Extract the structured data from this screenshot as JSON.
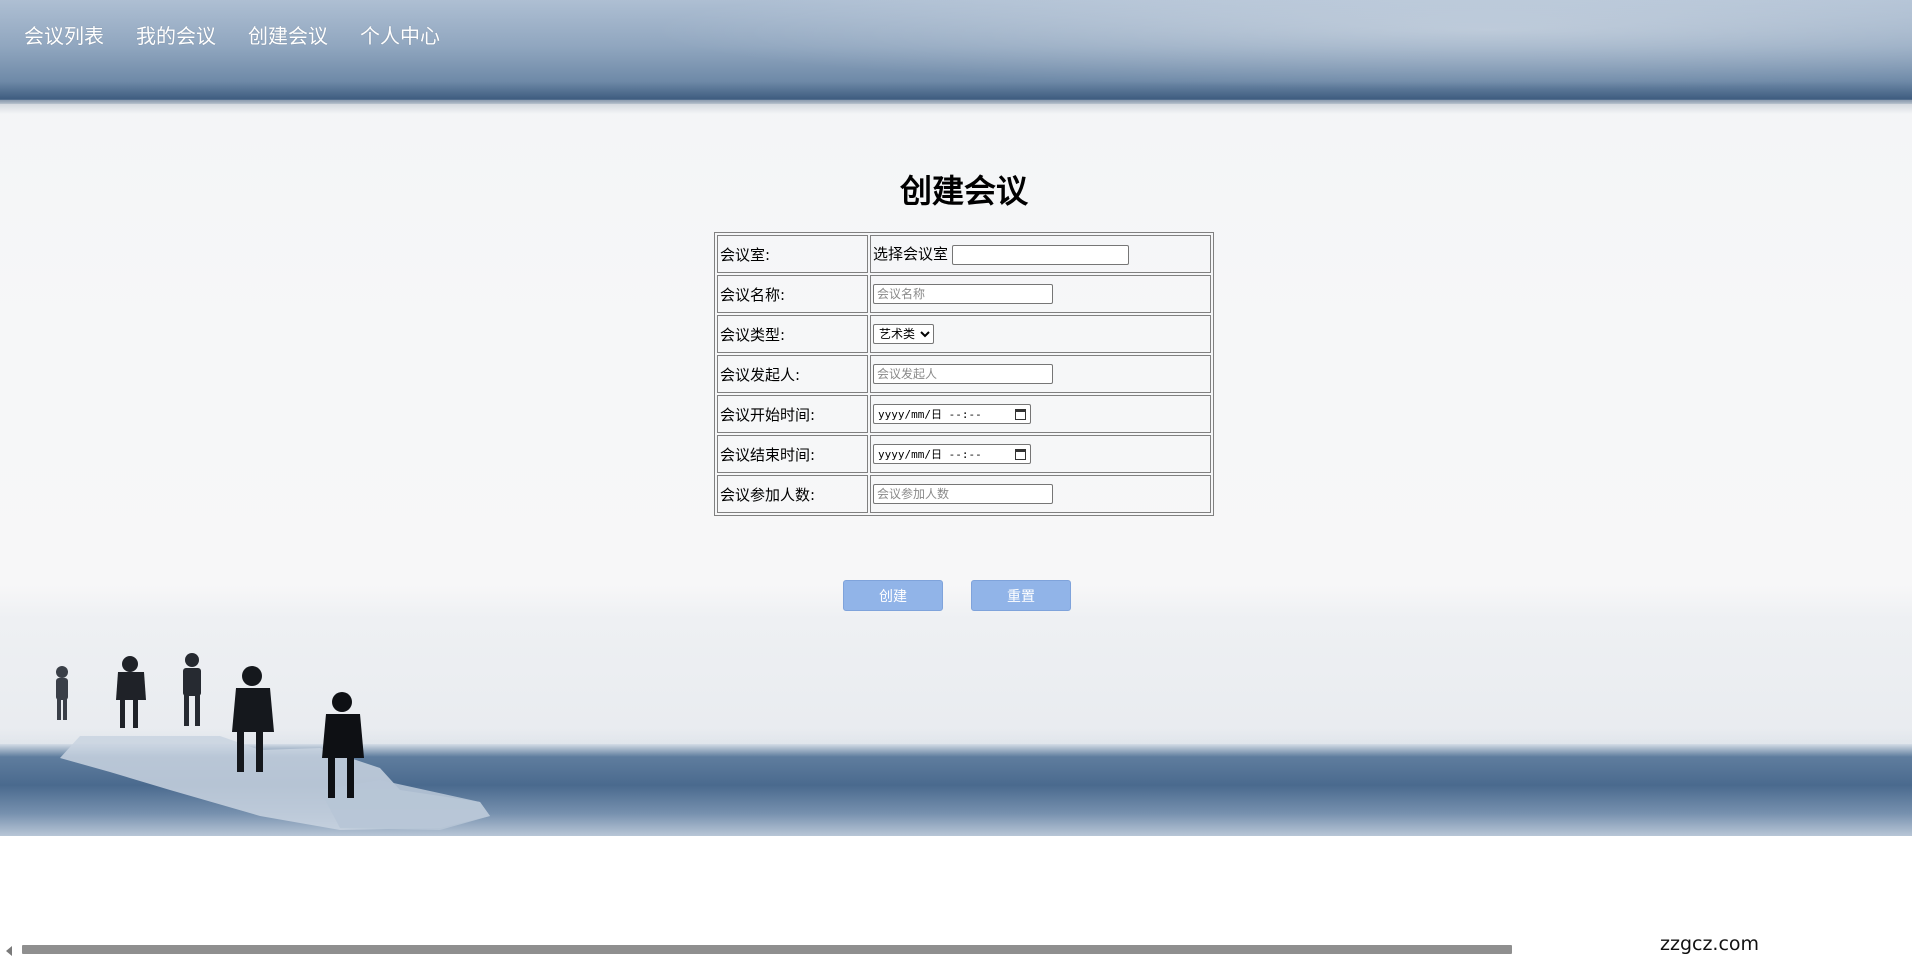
{
  "nav": {
    "items": [
      {
        "label": "会议列表"
      },
      {
        "label": "我的会议"
      },
      {
        "label": "创建会议"
      },
      {
        "label": "个人中心"
      }
    ]
  },
  "page_title": "创建会议",
  "form": {
    "room": {
      "label": "会议室:",
      "prompt": "选择会议室",
      "value": ""
    },
    "name": {
      "label": "会议名称:",
      "placeholder": "会议名称"
    },
    "type": {
      "label": "会议类型:",
      "selected": "艺术类"
    },
    "initiator": {
      "label": "会议发起人:",
      "placeholder": "会议发起人"
    },
    "start_time": {
      "label": "会议开始时间:",
      "value": "yyyy/mm/日 --:--"
    },
    "end_time": {
      "label": "会议结束时间:",
      "value": "yyyy/mm/日 --:--"
    },
    "attendees": {
      "label": "会议参加人数:",
      "placeholder": "会议参加人数"
    }
  },
  "buttons": {
    "create": "创建",
    "reset": "重置"
  },
  "watermark": "zzgcz.com",
  "colors": {
    "button_bg": "#91b4e8",
    "header_band": "#6f8aa8",
    "bottom_band": "#4a6a8e"
  }
}
